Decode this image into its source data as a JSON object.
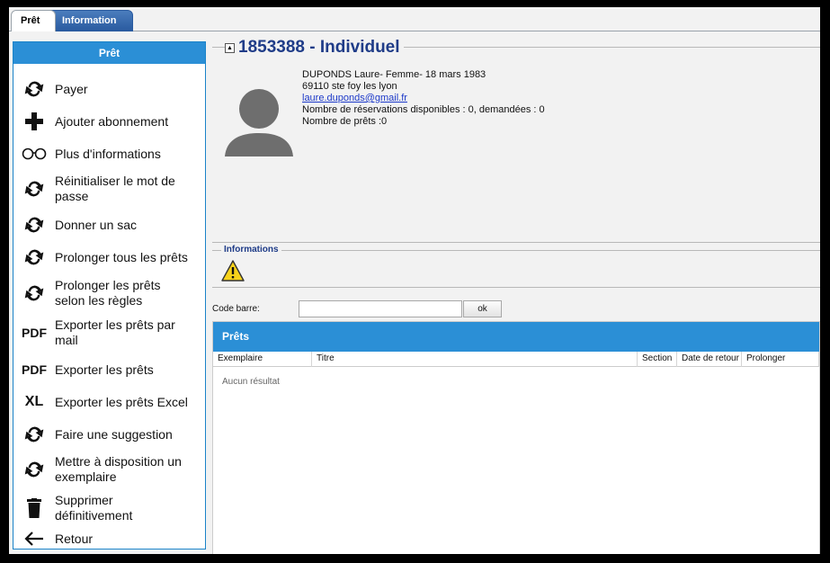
{
  "tabs": [
    {
      "label": "Prêt",
      "active": true
    },
    {
      "label": "Information",
      "active": false
    }
  ],
  "sidebar": {
    "header": "Prêt",
    "items": [
      {
        "label": "Payer",
        "icon": "refresh-icon"
      },
      {
        "label": "Ajouter abonnement",
        "icon": "plus-icon"
      },
      {
        "label": "Plus d'informations",
        "icon": "glasses-icon"
      },
      {
        "label": "Réinitialiser le mot de passe",
        "icon": "refresh-icon"
      },
      {
        "label": "Donner un sac",
        "icon": "refresh-icon"
      },
      {
        "label": "Prolonger tous les prêts",
        "icon": "refresh-icon"
      },
      {
        "label": "Prolonger les prêts selon les règles",
        "icon": "refresh-icon"
      },
      {
        "label": "Exporter les prêts par mail",
        "icon": "pdf-icon",
        "icon_text": "PDF"
      },
      {
        "label": "Exporter les prêts",
        "icon": "pdf-icon",
        "icon_text": "PDF"
      },
      {
        "label": "Exporter les prêts Excel",
        "icon": "excel-icon",
        "icon_text": "XL"
      },
      {
        "label": "Faire une suggestion",
        "icon": "refresh-icon"
      },
      {
        "label": "Mettre à disposition un exemplaire",
        "icon": "refresh-icon"
      },
      {
        "label": "Supprimer définitivement",
        "icon": "trash-icon"
      },
      {
        "label": "Retour",
        "icon": "arrow-left-icon"
      }
    ]
  },
  "user": {
    "title": "1853388 - Individuel",
    "line1": "DUPONDS Laure- Femme- 18 mars 1983",
    "line2": "69110 ste foy les lyon",
    "email": "laure.duponds@gmail.fr",
    "reservations": "Nombre de réservations disponibles : 0, demandées : 0",
    "loans_count": "Nombre de prêts :0"
  },
  "informations": {
    "legend": "Informations",
    "icon": "warning-icon"
  },
  "barcode": {
    "label": "Code barre:",
    "value": "",
    "button": "ok"
  },
  "loans": {
    "header": "Prêts",
    "columns": [
      "Exemplaire",
      "Titre",
      "Section",
      "Date de retour",
      "Prolonger"
    ],
    "empty_message": "Aucun résultat"
  },
  "colors": {
    "accent_blue": "#2b8fd6",
    "title_blue": "#1f3c88",
    "link_blue": "#1c39c9"
  }
}
